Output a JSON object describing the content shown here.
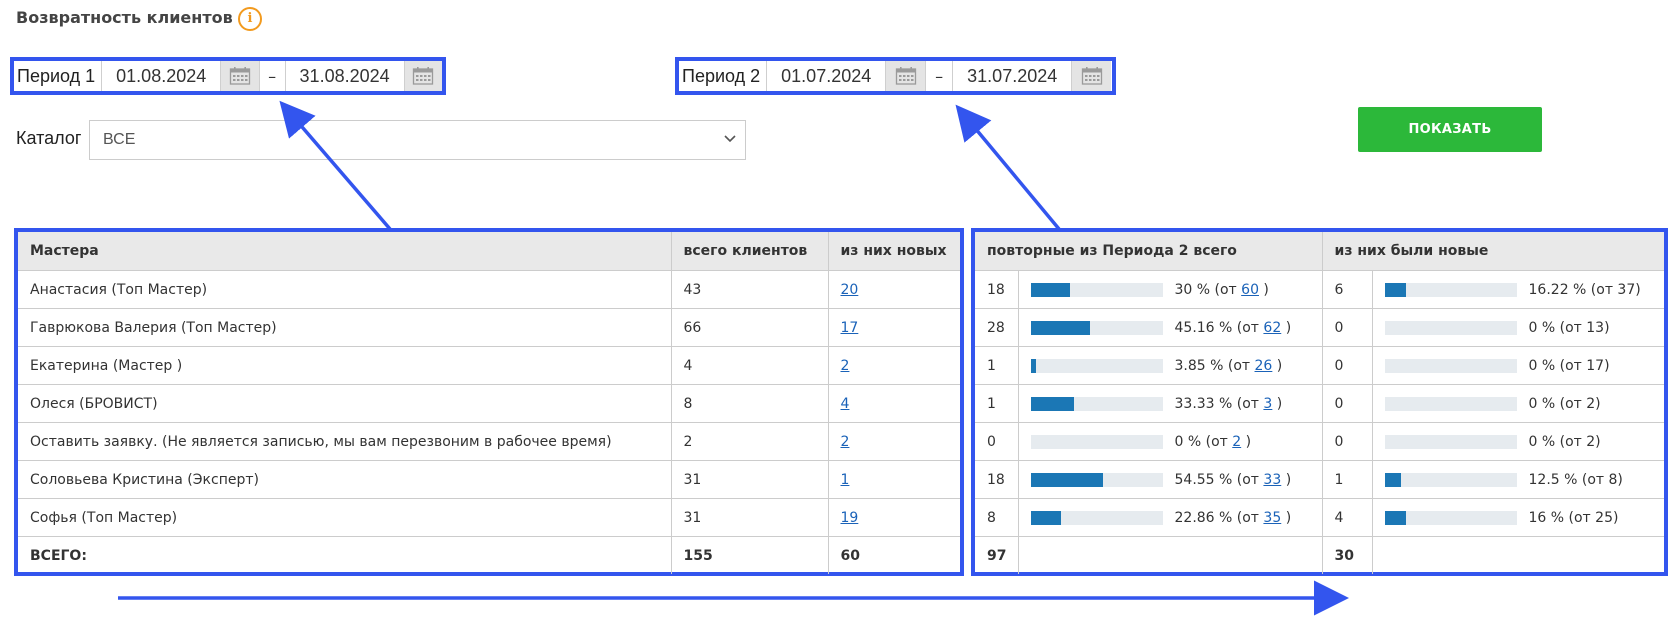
{
  "header": {
    "title": "Возвратность клиентов",
    "info_icon": "info-circle-icon"
  },
  "period1": {
    "label": "Период 1",
    "from": "01.08.2024",
    "to": "31.08.2024",
    "separator": "–"
  },
  "period2": {
    "label": "Период 2",
    "from": "01.07.2024",
    "to": "31.07.2024",
    "separator": "–"
  },
  "catalog": {
    "label": "Каталог",
    "selected": "ВСЕ"
  },
  "show_button": {
    "label": "ПОКАЗАТЬ",
    "color": "#2cb83a"
  },
  "accent_color": "#3355ee",
  "bar_color": "#1b77b5",
  "left_table": {
    "headers": [
      "Мастера",
      "всего клиентов",
      "из них новых"
    ],
    "rows": [
      {
        "master": "Анастасия (Топ Мастер)",
        "total": "43",
        "new": "20"
      },
      {
        "master": "Гаврюкова Валерия (Топ Мастер)",
        "total": "66",
        "new": "17"
      },
      {
        "master": "Екатерина (Мастер )",
        "total": "4",
        "new": "2"
      },
      {
        "master": "Олеся (БРОВИСТ)",
        "total": "8",
        "new": "4"
      },
      {
        "master": "Оставить заявку. (Не является записью, мы вам перезвоним в рабочее время)",
        "total": "2",
        "new": "2"
      },
      {
        "master": "Соловьева Кристина (Эксперт)",
        "total": "31",
        "new": "1"
      },
      {
        "master": "Софья (Топ Мастер)",
        "total": "31",
        "new": "19"
      }
    ],
    "total_row": {
      "label": "ВСЕГО:",
      "total": "155",
      "new": "60"
    }
  },
  "right_table": {
    "headers": [
      "повторные из Периода 2 всего",
      "из них были новые"
    ],
    "rows": [
      {
        "rep_count": "18",
        "rep_pct": 30,
        "rep_pct_label": "30 % (от ",
        "rep_of": "60",
        "new_count": "6",
        "new_pct": 16.22,
        "new_label": "16.22 % (от 37)"
      },
      {
        "rep_count": "28",
        "rep_pct": 45.16,
        "rep_pct_label": "45.16 % (от ",
        "rep_of": "62",
        "new_count": "0",
        "new_pct": 0,
        "new_label": "0 % (от 13)"
      },
      {
        "rep_count": "1",
        "rep_pct": 3.85,
        "rep_pct_label": "3.85 % (от ",
        "rep_of": "26",
        "new_count": "0",
        "new_pct": 0,
        "new_label": "0 % (от 17)"
      },
      {
        "rep_count": "1",
        "rep_pct": 33.33,
        "rep_pct_label": "33.33 % (от ",
        "rep_of": "3",
        "new_count": "0",
        "new_pct": 0,
        "new_label": "0 % (от 2)"
      },
      {
        "rep_count": "0",
        "rep_pct": 0,
        "rep_pct_label": "0 % (от ",
        "rep_of": "2",
        "new_count": "0",
        "new_pct": 0,
        "new_label": "0 % (от 2)"
      },
      {
        "rep_count": "18",
        "rep_pct": 54.55,
        "rep_pct_label": "54.55 % (от ",
        "rep_of": "33",
        "new_count": "1",
        "new_pct": 12.5,
        "new_label": "12.5 % (от 8)"
      },
      {
        "rep_count": "8",
        "rep_pct": 22.86,
        "rep_pct_label": "22.86 % (от ",
        "rep_of": "35",
        "new_count": "4",
        "new_pct": 16,
        "new_label": "16 % (от 25)"
      }
    ],
    "total_row": {
      "rep_total": "97",
      "new_total": "30"
    }
  }
}
